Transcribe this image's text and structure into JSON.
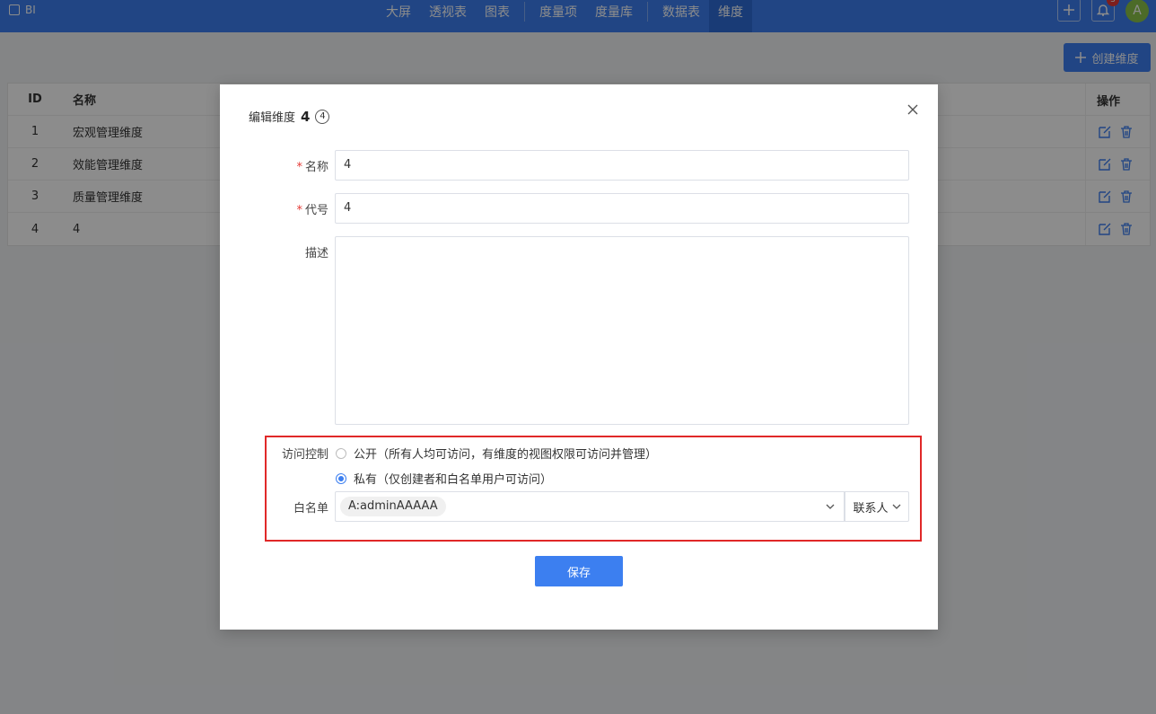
{
  "brand": {
    "name": "BI",
    "icon": "shield-logo-icon"
  },
  "nav": {
    "items": [
      {
        "label": "大屏"
      },
      {
        "label": "透视表"
      },
      {
        "label": "图表"
      },
      {
        "label": "度量项"
      },
      {
        "label": "度量库"
      },
      {
        "label": "数据表"
      },
      {
        "label": "维度",
        "active": true
      }
    ]
  },
  "topRight": {
    "notify_count": "3",
    "avatar_initial": "A"
  },
  "toolbar": {
    "create_label": "创建维度"
  },
  "table": {
    "headers": {
      "id": "ID",
      "name": "名称",
      "ops": "操作"
    },
    "rows": [
      {
        "id": "1",
        "name": "宏观管理维度"
      },
      {
        "id": "2",
        "name": "效能管理维度"
      },
      {
        "id": "3",
        "name": "质量管理维度"
      },
      {
        "id": "4",
        "name": "4"
      }
    ]
  },
  "modal": {
    "title_prefix": "编辑维度",
    "title_value": "4",
    "title_badge": "4",
    "fields": {
      "name_label": "名称",
      "name_value": "4",
      "code_label": "代号",
      "code_value": "4",
      "desc_label": "描述",
      "desc_value": ""
    },
    "access": {
      "label": "访问控制",
      "public_label": "公开（所有人均可访问，有维度的视图权限可访问并管理）",
      "private_label": "私有（仅创建者和白名单用户可访问）",
      "selected": "private"
    },
    "whitelist": {
      "label": "白名单",
      "tag": "A:adminAAAAA",
      "type_label": "联系人"
    },
    "save_label": "保存"
  },
  "colors": {
    "primary": "#3c7ff0",
    "danger": "#e02828"
  }
}
